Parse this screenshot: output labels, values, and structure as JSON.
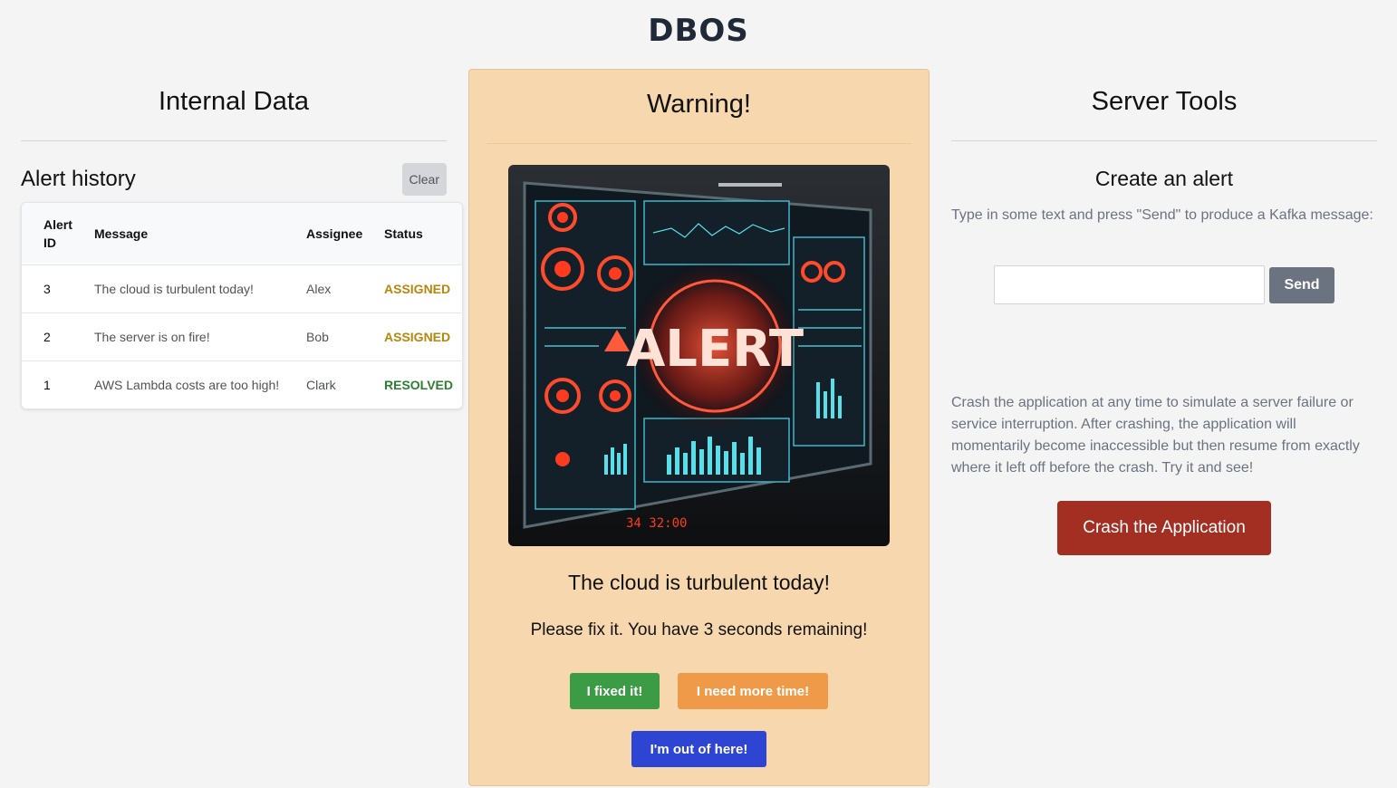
{
  "brand": {
    "logo_text": "DBOS"
  },
  "internal": {
    "title": "Internal Data",
    "history_title": "Alert history",
    "clear_label": "Clear",
    "columns": [
      "Alert ID",
      "Message",
      "Assignee",
      "Status"
    ],
    "rows": [
      {
        "id": "3",
        "message": "The cloud is turbulent today!",
        "assignee": "Alex",
        "status": "ASSIGNED"
      },
      {
        "id": "2",
        "message": "The server is on fire!",
        "assignee": "Bob",
        "status": "ASSIGNED"
      },
      {
        "id": "1",
        "message": "AWS Lambda costs are too high!",
        "assignee": "Clark",
        "status": "RESOLVED"
      }
    ],
    "status_colors": {
      "ASSIGNED": "#b8860b",
      "RESOLVED": "#2e7d32"
    }
  },
  "warning": {
    "title": "Warning!",
    "image_text": "ALERT",
    "message": "The cloud is turbulent today!",
    "countdown": "Please fix it. You have 3 seconds remaining!",
    "fixed_label": "I fixed it!",
    "more_time_label": "I need more time!",
    "out_label": "I'm out of here!",
    "panel_color": "#f7d8ae"
  },
  "server": {
    "title": "Server Tools",
    "create_title": "Create an alert",
    "create_desc": "Type in some text and press \"Send\" to produce a Kafka message:",
    "input_value": "",
    "send_label": "Send",
    "crash_desc": "Crash the application at any time to simulate a server failure or service interruption. After crashing, the application will momentarily become inaccessible but then resume from exactly where it left off before the crash. Try it and see!",
    "crash_label": "Crash the Application"
  }
}
